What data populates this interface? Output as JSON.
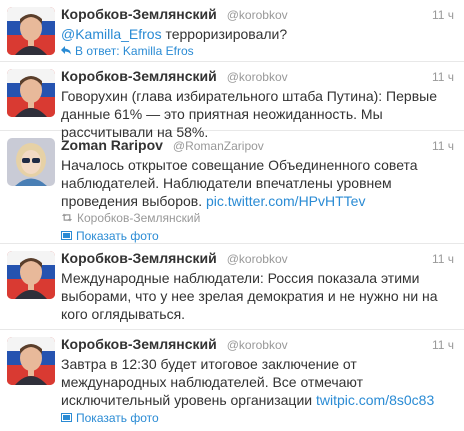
{
  "tweets": [
    {
      "fullname": "Коробков-Землянский",
      "username": "@korobkov",
      "time": "11 ч",
      "mention": "@Kamilla_Efros",
      "text": " терроризировали?",
      "reply_label": "В ответ: Kamilla Efros"
    },
    {
      "fullname": "Коробков-Землянский",
      "username": "@korobkov",
      "time": "11 ч",
      "text": "Говорухин (глава избирательного штаба Путина): Первые данные 61% — это приятная неожиданность. Мы рассчитывали на 58%."
    },
    {
      "fullname": "Zoman Raripov",
      "username": "@RomanZaripov",
      "time": "11 ч",
      "text": "Началось открытое совещание Объединенного совета наблюдателей. Наблюдатели впечатлены уровнем проведения выборов. ",
      "link": "pic.twitter.com/HPvHTTev",
      "retweeted_by": "Коробков-Землянский",
      "photo_label": "Показать фото"
    },
    {
      "fullname": "Коробков-Землянский",
      "username": "@korobkov",
      "time": "11 ч",
      "text": "Международные наблюдатели: Россия показала этими выборами, что у нее зрелая демократия и не нужно ни на кого оглядываться."
    },
    {
      "fullname": "Коробков-Землянский",
      "username": "@korobkov",
      "time": "11 ч",
      "text": "Завтра в 12:30 будет итоговое заключение от международных наблюдателей. Все отмечают исключительный уровень организации ",
      "link": "twitpic.com/8s0c83",
      "photo_label": "Показать фото"
    }
  ],
  "icons": {
    "reply": "reply-arrow-icon",
    "retweet": "retweet-icon",
    "photo": "photo-icon"
  },
  "colors": {
    "link": "#2a8bd4",
    "muted": "#999999",
    "text": "#333333"
  }
}
